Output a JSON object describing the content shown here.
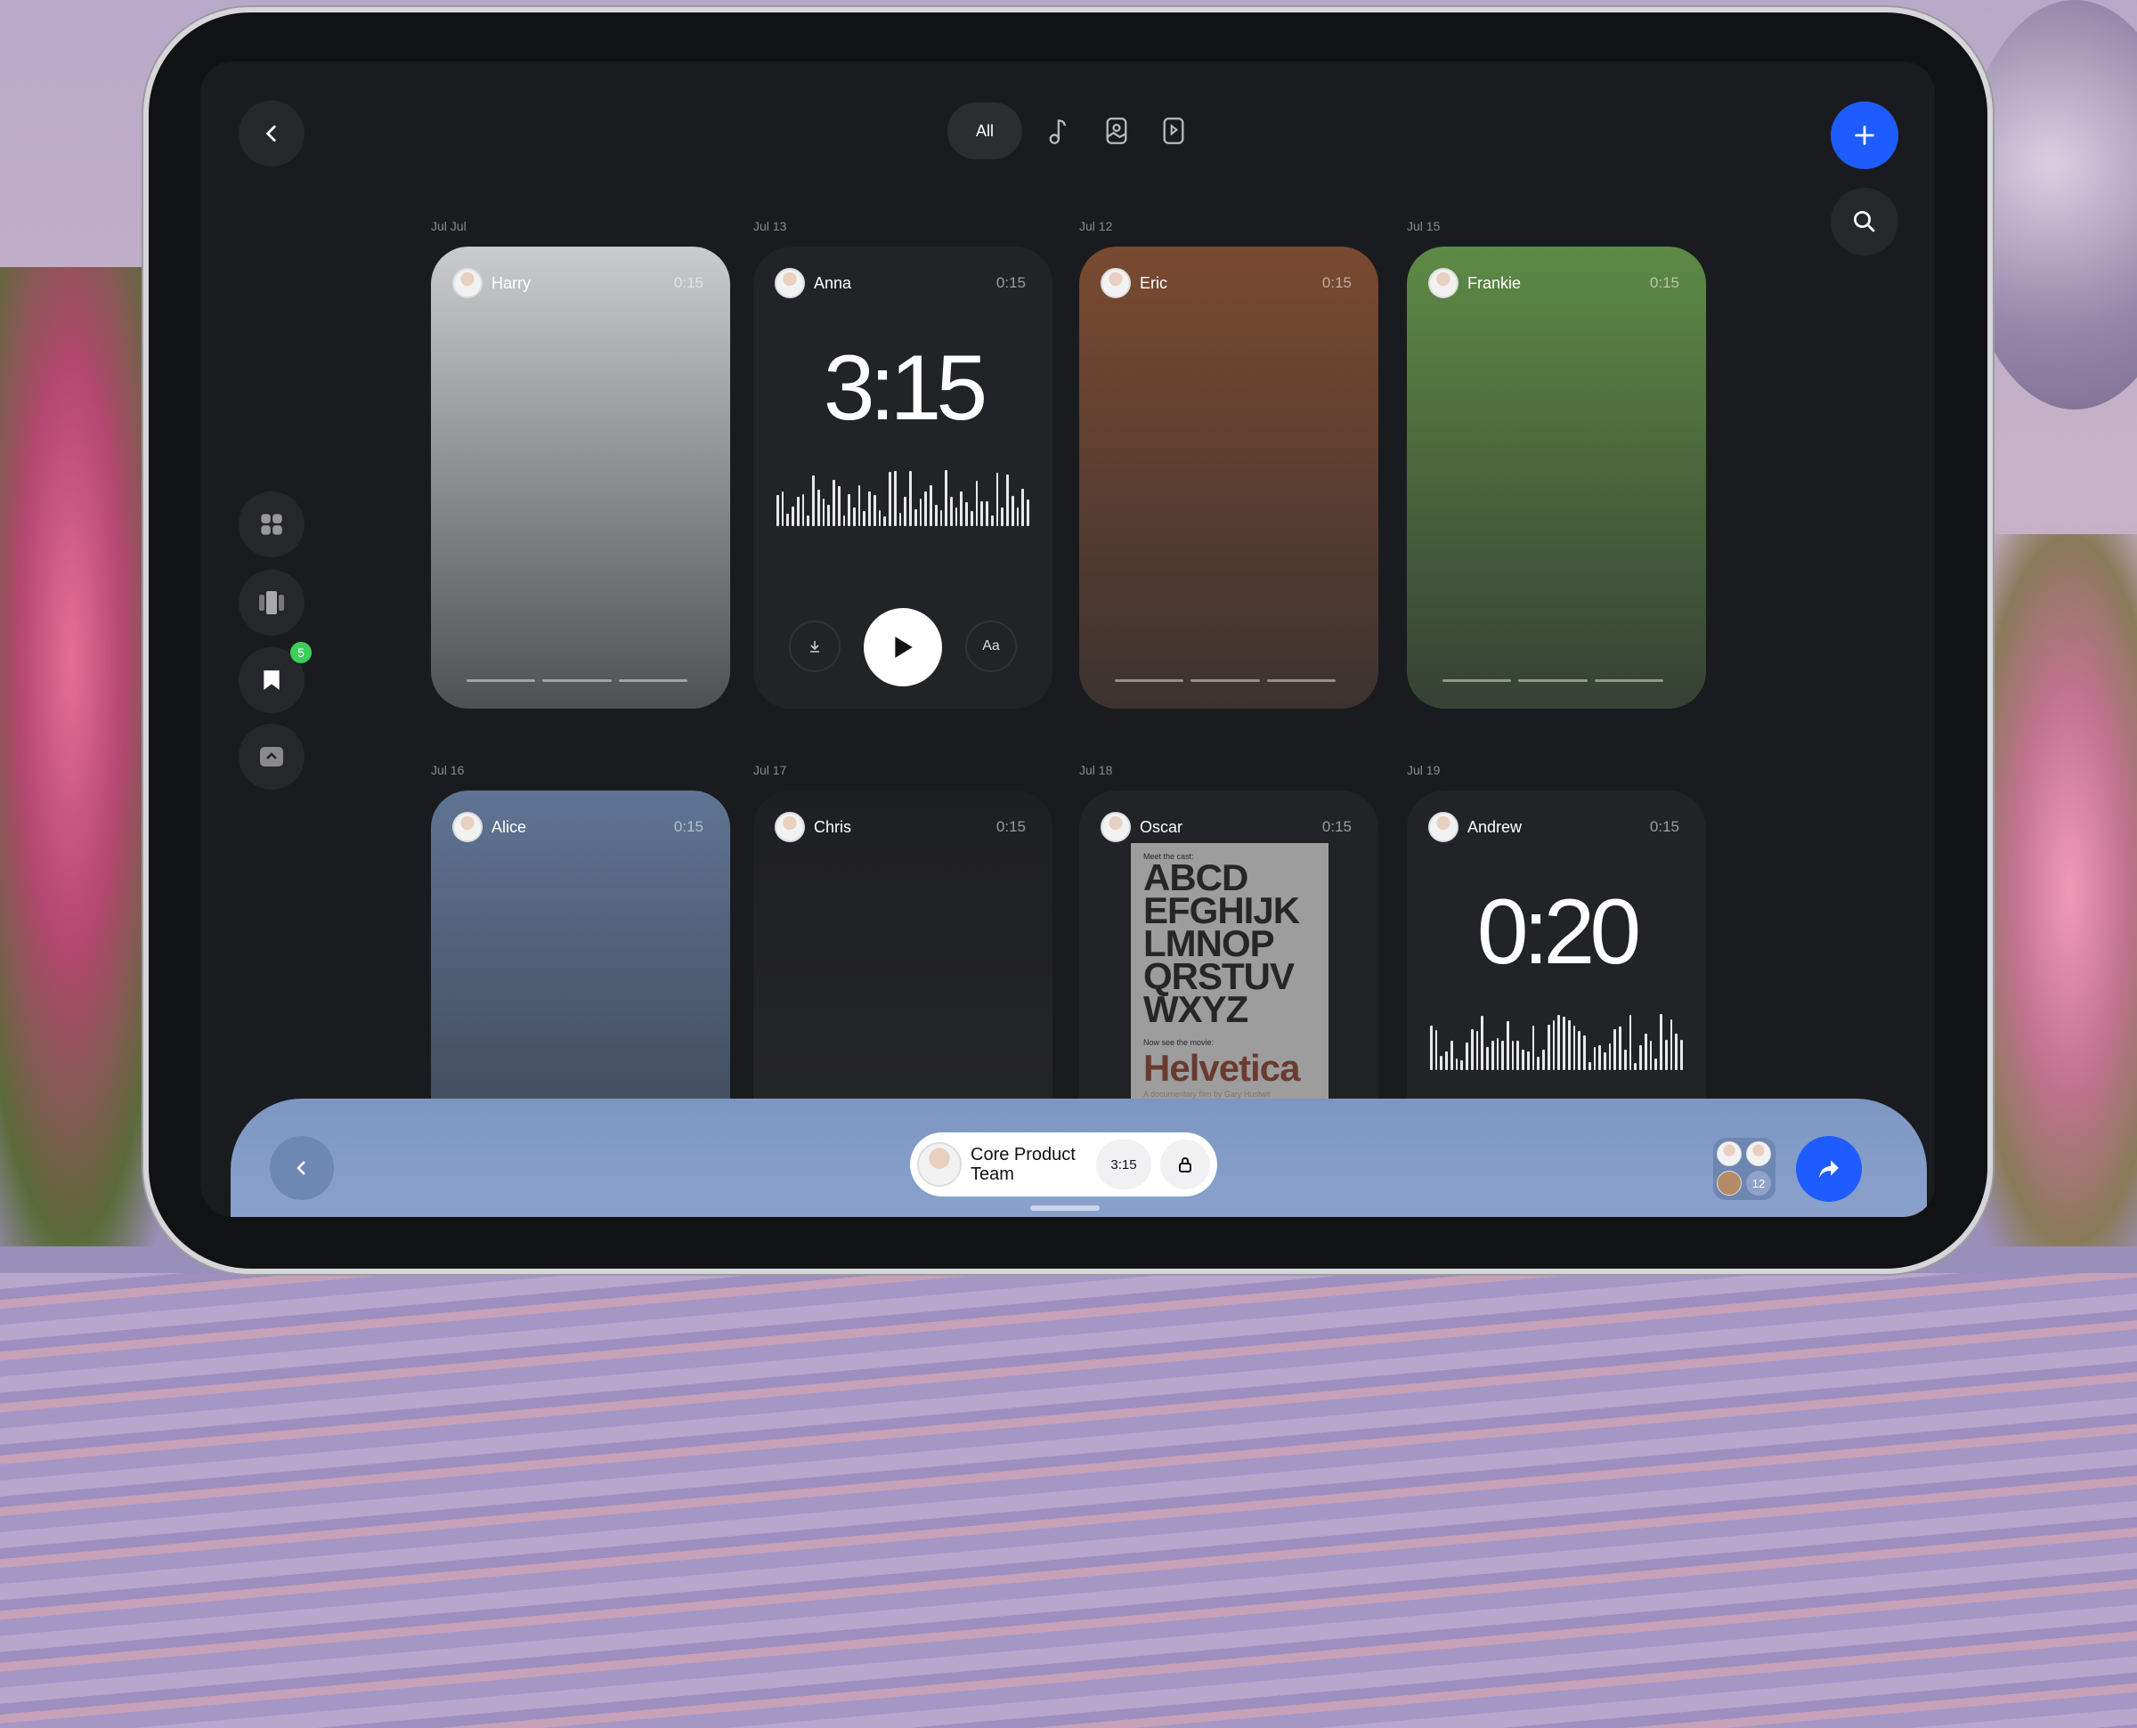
{
  "top": {
    "filter_all": "All",
    "filter_icons": [
      "music-note-icon",
      "image-file-icon",
      "video-file-icon"
    ]
  },
  "sidebar": {
    "items": [
      "grid-icon",
      "carousel-icon",
      "bookmark-icon",
      "collapse-icon"
    ],
    "badge": "5"
  },
  "row1": [
    {
      "date": "Jul Jul",
      "name": "Harry",
      "duration": "0:15",
      "type": "image",
      "bg": "#c9cccd"
    },
    {
      "date": "Jul 13",
      "name": "Anna",
      "duration": "0:15",
      "type": "audio",
      "time": "3:15",
      "text_btn": "Aa"
    },
    {
      "date": "Jul 12",
      "name": "Eric",
      "duration": "0:15",
      "type": "image",
      "bg": "#7a4a31"
    },
    {
      "date": "Jul 15",
      "name": "Frankie",
      "duration": "0:15",
      "type": "image",
      "bg": "#5d8a45"
    }
  ],
  "row2": [
    {
      "date": "Jul  16",
      "name": "Alice",
      "duration": "0:15",
      "type": "image",
      "bg": "#5f7494"
    },
    {
      "date": "Jul 17",
      "name": "Chris",
      "duration": "0:15",
      "type": "image",
      "bg": "#1e1f23"
    },
    {
      "date": "Jul 18",
      "name": "Oscar",
      "duration": "0:15",
      "type": "poster",
      "poster": {
        "kicker": "Meet the cast:",
        "letters": [
          "ABCD",
          "EFGHIJK",
          "LMNOP",
          "QRSTUV",
          "WXYZ"
        ],
        "sub": "Now see the movie:",
        "title": "Helvetica",
        "credit": "A documentary film by Gary Hustwit"
      }
    },
    {
      "date": "Jul 19",
      "name": "Andrew",
      "duration": "0:15",
      "type": "audio",
      "time": "0:20"
    }
  ],
  "bottom": {
    "group_name_1": "Core Product",
    "group_name_2": "Team",
    "time": "3:15",
    "member_count": "12"
  },
  "colors": {
    "accent": "#1f5cff",
    "badge": "#3ccf5a",
    "bottom_bar": "#7e97c3"
  }
}
